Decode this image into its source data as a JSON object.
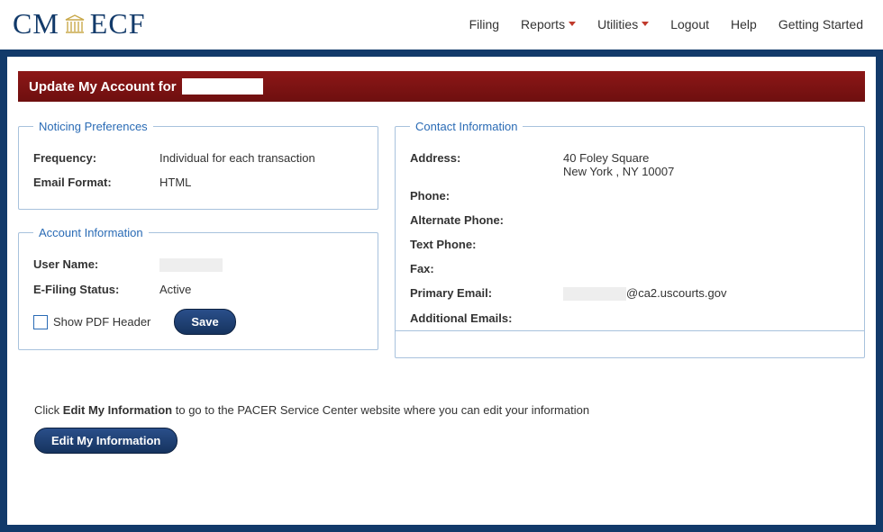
{
  "nav": {
    "filing": "Filing",
    "reports": "Reports",
    "utilities": "Utilities",
    "logout": "Logout",
    "help": "Help",
    "getting_started": "Getting Started"
  },
  "page_title_prefix": "Update My Account for",
  "noticing": {
    "legend": "Noticing Preferences",
    "frequency_label": "Frequency:",
    "frequency_value": "Individual for each transaction",
    "email_format_label": "Email Format:",
    "email_format_value": "HTML"
  },
  "account": {
    "legend": "Account Information",
    "username_label": "User Name:",
    "efiling_label": "E-Filing Status:",
    "efiling_value": "Active",
    "show_pdf_header_label": "Show PDF Header",
    "save_button": "Save"
  },
  "contact": {
    "legend": "Contact Information",
    "address_label": "Address:",
    "address_line1": "40 Foley Square",
    "address_line2": "New York , NY  10007",
    "phone_label": "Phone:",
    "alt_phone_label": "Alternate Phone:",
    "text_phone_label": "Text Phone:",
    "fax_label": "Fax:",
    "primary_email_label": "Primary Email:",
    "primary_email_suffix": "@ca2.uscourts.gov",
    "additional_emails_label": "Additional Emails:"
  },
  "hint_prefix": "Click ",
  "hint_bold": "Edit My Information",
  "hint_suffix": " to go to the PACER Service Center website where you can edit your information",
  "edit_button": "Edit My Information"
}
